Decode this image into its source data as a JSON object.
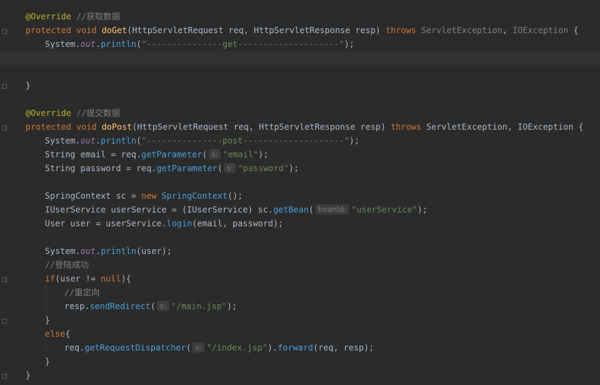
{
  "lines": [
    {
      "id": "l1",
      "tokens": [
        [
          "ann",
          "@Override"
        ],
        [
          "cmt",
          " //获取数据"
        ]
      ]
    },
    {
      "id": "l2",
      "tokens": [
        [
          "kw",
          "protected void "
        ],
        [
          "fn",
          "doGet"
        ],
        [
          "txt",
          "(HttpServletRequest req, HttpServletResponse resp) "
        ],
        [
          "kw",
          "throws "
        ],
        [
          "exc",
          "ServletException"
        ],
        [
          "txt",
          ", "
        ],
        [
          "exc",
          "IOException"
        ],
        [
          "txt",
          " {"
        ]
      ]
    },
    {
      "id": "l3",
      "tokens": [
        [
          "txt",
          "System."
        ],
        [
          "fld",
          "out"
        ],
        [
          "txt",
          "."
        ],
        [
          "call",
          "println"
        ],
        [
          "txt",
          "("
        ],
        [
          "str",
          "\"---------------get--------------------\""
        ],
        [
          "txt",
          ");"
        ]
      ]
    },
    {
      "id": "l4",
      "tokens": []
    },
    {
      "id": "l5",
      "tokens": []
    },
    {
      "id": "l6",
      "tokens": [
        [
          "txt",
          "}"
        ]
      ]
    },
    {
      "id": "l7",
      "tokens": []
    },
    {
      "id": "l8",
      "tokens": [
        [
          "ann",
          "@Override"
        ],
        [
          "cmt",
          " //提交数据"
        ]
      ]
    },
    {
      "id": "l9",
      "tokens": [
        [
          "kw",
          "protected void "
        ],
        [
          "fn",
          "doPost"
        ],
        [
          "txt",
          "(HttpServletRequest req, HttpServletResponse resp) "
        ],
        [
          "kw",
          "throws "
        ],
        [
          "txt",
          "ServletException, IOException {"
        ]
      ]
    },
    {
      "id": "l10",
      "tokens": [
        [
          "txt",
          "System."
        ],
        [
          "fld",
          "out"
        ],
        [
          "txt",
          "."
        ],
        [
          "call",
          "println"
        ],
        [
          "txt",
          "("
        ],
        [
          "str",
          "\"---------------post--------------------\""
        ],
        [
          "txt",
          ");"
        ]
      ]
    },
    {
      "id": "l11",
      "tokens": [
        [
          "txt",
          "String email = req."
        ],
        [
          "call",
          "getParameter"
        ],
        [
          "txt",
          "("
        ],
        [
          "hint",
          "s:"
        ],
        [
          "str",
          "\"email\""
        ],
        [
          "txt",
          ");"
        ]
      ]
    },
    {
      "id": "l12",
      "tokens": [
        [
          "txt",
          "String password = req."
        ],
        [
          "call",
          "getParameter"
        ],
        [
          "txt",
          "("
        ],
        [
          "hint",
          "s:"
        ],
        [
          "str",
          "\"password\""
        ],
        [
          "txt",
          ");"
        ]
      ]
    },
    {
      "id": "l13",
      "tokens": []
    },
    {
      "id": "l14",
      "tokens": [
        [
          "txt",
          "SpringContext sc = "
        ],
        [
          "kw",
          "new "
        ],
        [
          "call",
          "SpringContext"
        ],
        [
          "txt",
          "();"
        ]
      ]
    },
    {
      "id": "l15",
      "tokens": [
        [
          "txt",
          "IUserService userService = (IUserService) sc."
        ],
        [
          "call",
          "getBean"
        ],
        [
          "txt",
          "("
        ],
        [
          "hint",
          "beanId:"
        ],
        [
          "str",
          "\"userService\""
        ],
        [
          "txt",
          ");"
        ]
      ]
    },
    {
      "id": "l16",
      "tokens": [
        [
          "txt",
          "User user = userService."
        ],
        [
          "call",
          "login"
        ],
        [
          "txt",
          "(email, password);"
        ]
      ]
    },
    {
      "id": "l17",
      "tokens": []
    },
    {
      "id": "l18",
      "tokens": [
        [
          "txt",
          "System."
        ],
        [
          "fld",
          "out"
        ],
        [
          "txt",
          "."
        ],
        [
          "call",
          "println"
        ],
        [
          "txt",
          "(user);"
        ]
      ]
    },
    {
      "id": "l19",
      "tokens": [
        [
          "cmt",
          "//登陆成功"
        ]
      ]
    },
    {
      "id": "l20",
      "tokens": [
        [
          "kw",
          "if"
        ],
        [
          "txt",
          "(user != "
        ],
        [
          "kw",
          "null"
        ],
        [
          "txt",
          "){"
        ]
      ]
    },
    {
      "id": "l21",
      "tokens": [
        [
          "cmt",
          "//重定向"
        ]
      ]
    },
    {
      "id": "l22",
      "tokens": [
        [
          "txt",
          "resp."
        ],
        [
          "call",
          "sendRedirect"
        ],
        [
          "txt",
          "("
        ],
        [
          "hint",
          "s:"
        ],
        [
          "str",
          "\"/main.jsp\""
        ],
        [
          "txt",
          ");"
        ]
      ]
    },
    {
      "id": "l23",
      "tokens": [
        [
          "txt",
          "}"
        ]
      ]
    },
    {
      "id": "l24",
      "tokens": [
        [
          "kw",
          "else"
        ],
        [
          "txt",
          "{"
        ]
      ]
    },
    {
      "id": "l25",
      "tokens": [
        [
          "txt",
          "req."
        ],
        [
          "call",
          "getRequestDispatcher"
        ],
        [
          "txt",
          "("
        ],
        [
          "hint",
          "s:"
        ],
        [
          "str",
          "\"/index.jsp\""
        ],
        [
          "txt",
          ")."
        ],
        [
          "call",
          "forward"
        ],
        [
          "txt",
          "(req, resp);"
        ]
      ]
    },
    {
      "id": "l26",
      "tokens": [
        [
          "txt",
          "}"
        ]
      ]
    },
    {
      "id": "l27",
      "tokens": [
        [
          "txt",
          "}"
        ]
      ]
    }
  ]
}
